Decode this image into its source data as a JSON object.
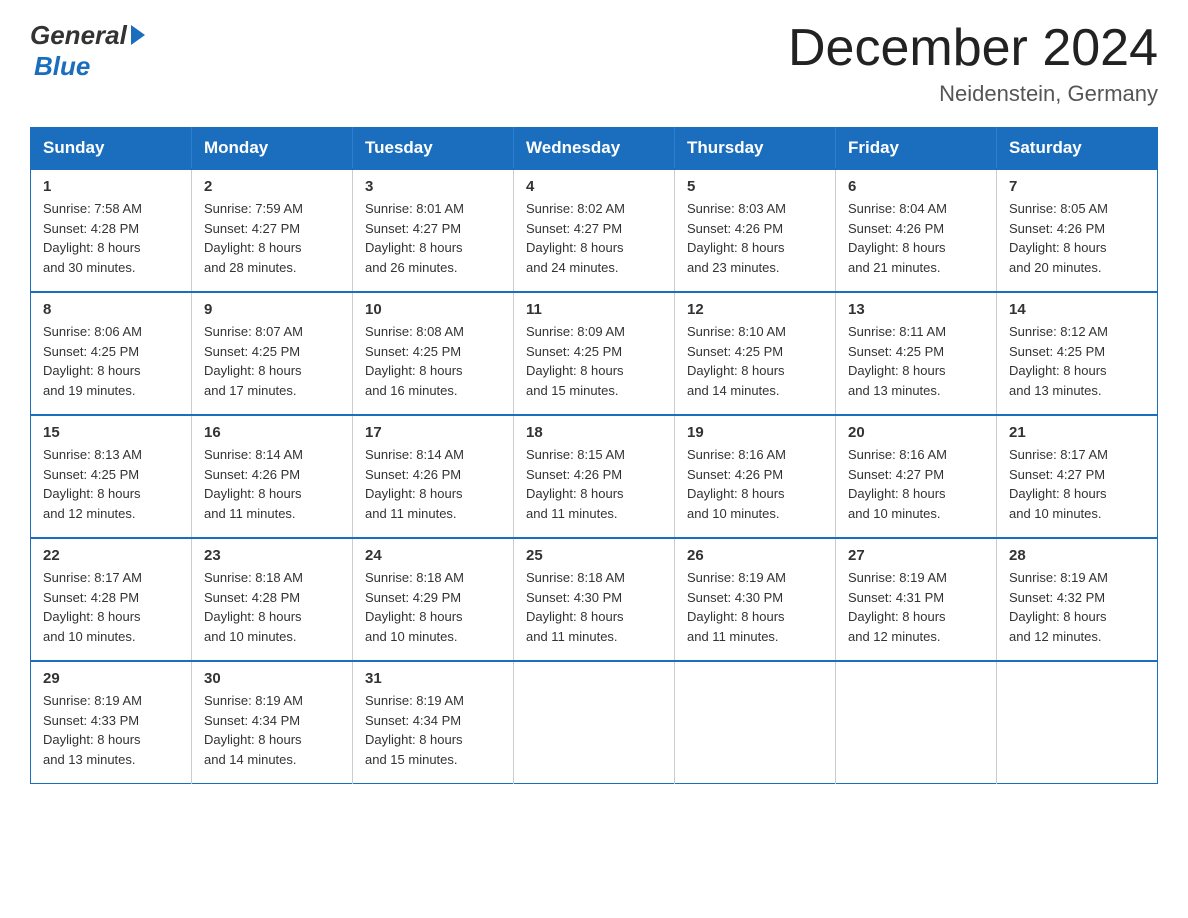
{
  "logo": {
    "general": "General",
    "blue": "Blue"
  },
  "title": {
    "month_year": "December 2024",
    "location": "Neidenstein, Germany"
  },
  "weekdays": [
    "Sunday",
    "Monday",
    "Tuesday",
    "Wednesday",
    "Thursday",
    "Friday",
    "Saturday"
  ],
  "weeks": [
    [
      {
        "day": "1",
        "sunrise": "7:58 AM",
        "sunset": "4:28 PM",
        "daylight": "8 hours and 30 minutes."
      },
      {
        "day": "2",
        "sunrise": "7:59 AM",
        "sunset": "4:27 PM",
        "daylight": "8 hours and 28 minutes."
      },
      {
        "day": "3",
        "sunrise": "8:01 AM",
        "sunset": "4:27 PM",
        "daylight": "8 hours and 26 minutes."
      },
      {
        "day": "4",
        "sunrise": "8:02 AM",
        "sunset": "4:27 PM",
        "daylight": "8 hours and 24 minutes."
      },
      {
        "day": "5",
        "sunrise": "8:03 AM",
        "sunset": "4:26 PM",
        "daylight": "8 hours and 23 minutes."
      },
      {
        "day": "6",
        "sunrise": "8:04 AM",
        "sunset": "4:26 PM",
        "daylight": "8 hours and 21 minutes."
      },
      {
        "day": "7",
        "sunrise": "8:05 AM",
        "sunset": "4:26 PM",
        "daylight": "8 hours and 20 minutes."
      }
    ],
    [
      {
        "day": "8",
        "sunrise": "8:06 AM",
        "sunset": "4:25 PM",
        "daylight": "8 hours and 19 minutes."
      },
      {
        "day": "9",
        "sunrise": "8:07 AM",
        "sunset": "4:25 PM",
        "daylight": "8 hours and 17 minutes."
      },
      {
        "day": "10",
        "sunrise": "8:08 AM",
        "sunset": "4:25 PM",
        "daylight": "8 hours and 16 minutes."
      },
      {
        "day": "11",
        "sunrise": "8:09 AM",
        "sunset": "4:25 PM",
        "daylight": "8 hours and 15 minutes."
      },
      {
        "day": "12",
        "sunrise": "8:10 AM",
        "sunset": "4:25 PM",
        "daylight": "8 hours and 14 minutes."
      },
      {
        "day": "13",
        "sunrise": "8:11 AM",
        "sunset": "4:25 PM",
        "daylight": "8 hours and 13 minutes."
      },
      {
        "day": "14",
        "sunrise": "8:12 AM",
        "sunset": "4:25 PM",
        "daylight": "8 hours and 13 minutes."
      }
    ],
    [
      {
        "day": "15",
        "sunrise": "8:13 AM",
        "sunset": "4:25 PM",
        "daylight": "8 hours and 12 minutes."
      },
      {
        "day": "16",
        "sunrise": "8:14 AM",
        "sunset": "4:26 PM",
        "daylight": "8 hours and 11 minutes."
      },
      {
        "day": "17",
        "sunrise": "8:14 AM",
        "sunset": "4:26 PM",
        "daylight": "8 hours and 11 minutes."
      },
      {
        "day": "18",
        "sunrise": "8:15 AM",
        "sunset": "4:26 PM",
        "daylight": "8 hours and 11 minutes."
      },
      {
        "day": "19",
        "sunrise": "8:16 AM",
        "sunset": "4:26 PM",
        "daylight": "8 hours and 10 minutes."
      },
      {
        "day": "20",
        "sunrise": "8:16 AM",
        "sunset": "4:27 PM",
        "daylight": "8 hours and 10 minutes."
      },
      {
        "day": "21",
        "sunrise": "8:17 AM",
        "sunset": "4:27 PM",
        "daylight": "8 hours and 10 minutes."
      }
    ],
    [
      {
        "day": "22",
        "sunrise": "8:17 AM",
        "sunset": "4:28 PM",
        "daylight": "8 hours and 10 minutes."
      },
      {
        "day": "23",
        "sunrise": "8:18 AM",
        "sunset": "4:28 PM",
        "daylight": "8 hours and 10 minutes."
      },
      {
        "day": "24",
        "sunrise": "8:18 AM",
        "sunset": "4:29 PM",
        "daylight": "8 hours and 10 minutes."
      },
      {
        "day": "25",
        "sunrise": "8:18 AM",
        "sunset": "4:30 PM",
        "daylight": "8 hours and 11 minutes."
      },
      {
        "day": "26",
        "sunrise": "8:19 AM",
        "sunset": "4:30 PM",
        "daylight": "8 hours and 11 minutes."
      },
      {
        "day": "27",
        "sunrise": "8:19 AM",
        "sunset": "4:31 PM",
        "daylight": "8 hours and 12 minutes."
      },
      {
        "day": "28",
        "sunrise": "8:19 AM",
        "sunset": "4:32 PM",
        "daylight": "8 hours and 12 minutes."
      }
    ],
    [
      {
        "day": "29",
        "sunrise": "8:19 AM",
        "sunset": "4:33 PM",
        "daylight": "8 hours and 13 minutes."
      },
      {
        "day": "30",
        "sunrise": "8:19 AM",
        "sunset": "4:34 PM",
        "daylight": "8 hours and 14 minutes."
      },
      {
        "day": "31",
        "sunrise": "8:19 AM",
        "sunset": "4:34 PM",
        "daylight": "8 hours and 15 minutes."
      },
      null,
      null,
      null,
      null
    ]
  ],
  "labels": {
    "sunrise": "Sunrise:",
    "sunset": "Sunset:",
    "daylight": "Daylight:"
  }
}
